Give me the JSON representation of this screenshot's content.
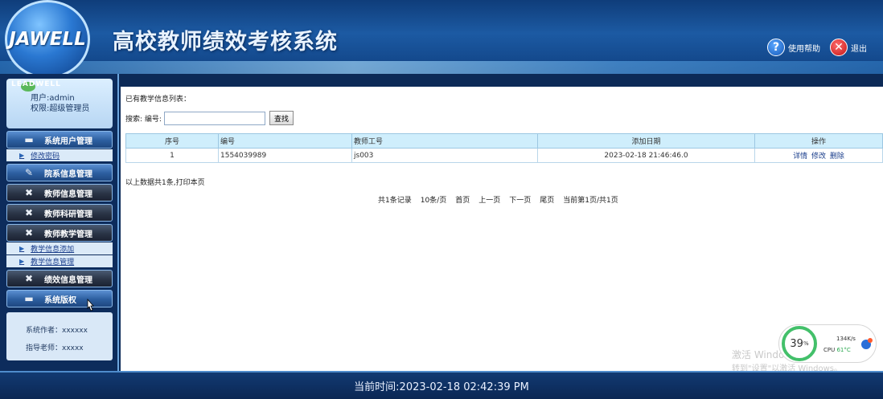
{
  "header": {
    "logo_text": "JAWELL",
    "title": "高校教师绩效考核系统",
    "help_label": "使用帮助",
    "exit_label": "退出"
  },
  "sidebar": {
    "user_banner": "LEADWELL",
    "user_line": "用户:admin",
    "role_line": "权限:超级管理员",
    "menu": [
      {
        "label": "系统用户管理",
        "icon": "monitor-icon"
      },
      {
        "label": "修改密码",
        "type": "sub"
      },
      {
        "label": "院系信息管理",
        "icon": "pen-icon"
      },
      {
        "label": "教师信息管理",
        "icon": "tools-icon"
      },
      {
        "label": "教师科研管理",
        "icon": "tools-icon"
      },
      {
        "label": "教师教学管理",
        "icon": "tools-icon"
      },
      {
        "label": "教学信息添加",
        "type": "sub"
      },
      {
        "label": "教学信息管理",
        "type": "sub"
      },
      {
        "label": "绩效信息管理",
        "icon": "tools-icon"
      },
      {
        "label": "系统版权",
        "icon": "monitor-icon"
      }
    ],
    "footer_author": "系统作者：xxxxxx",
    "footer_teacher": "指导老师：xxxxx"
  },
  "main": {
    "heading": "已有教学信息列表：",
    "search_label": "搜索: 编号:",
    "search_value": "",
    "search_button": "查找",
    "columns": [
      "序号",
      "编号",
      "教师工号",
      "添加日期",
      "操作"
    ],
    "rows": [
      {
        "seq": "1",
        "code": "1554039989",
        "teacher_no": "js003",
        "date": "2023-02-18 21:46:46.0",
        "ops": [
          "详情",
          "修改",
          "删除"
        ]
      }
    ],
    "print_line": "以上数据共1条,打印本页",
    "pager": {
      "total": "共1条记录",
      "per_page": "10条/页",
      "first": "首页",
      "prev": "上一页",
      "next": "下一页",
      "last": "尾页",
      "current": "当前第1页/共1页"
    }
  },
  "overlay": {
    "watermark_line1": "激活 Windows",
    "watermark_line2": "转到\"设置\"以激活 Windows。",
    "gauge_value": "39",
    "gauge_unit": "%",
    "net_speed": "134K/s",
    "cpu_label": "CPU",
    "cpu_temp": "61°C"
  },
  "footer": {
    "time_text": "当前时间:2023-02-18 02:42:39 PM"
  },
  "colors": {
    "header_bg": "#1c5aa3",
    "table_header_bg": "#cfeefc",
    "link": "#1a3e8c",
    "gauge": "#43c06a"
  }
}
